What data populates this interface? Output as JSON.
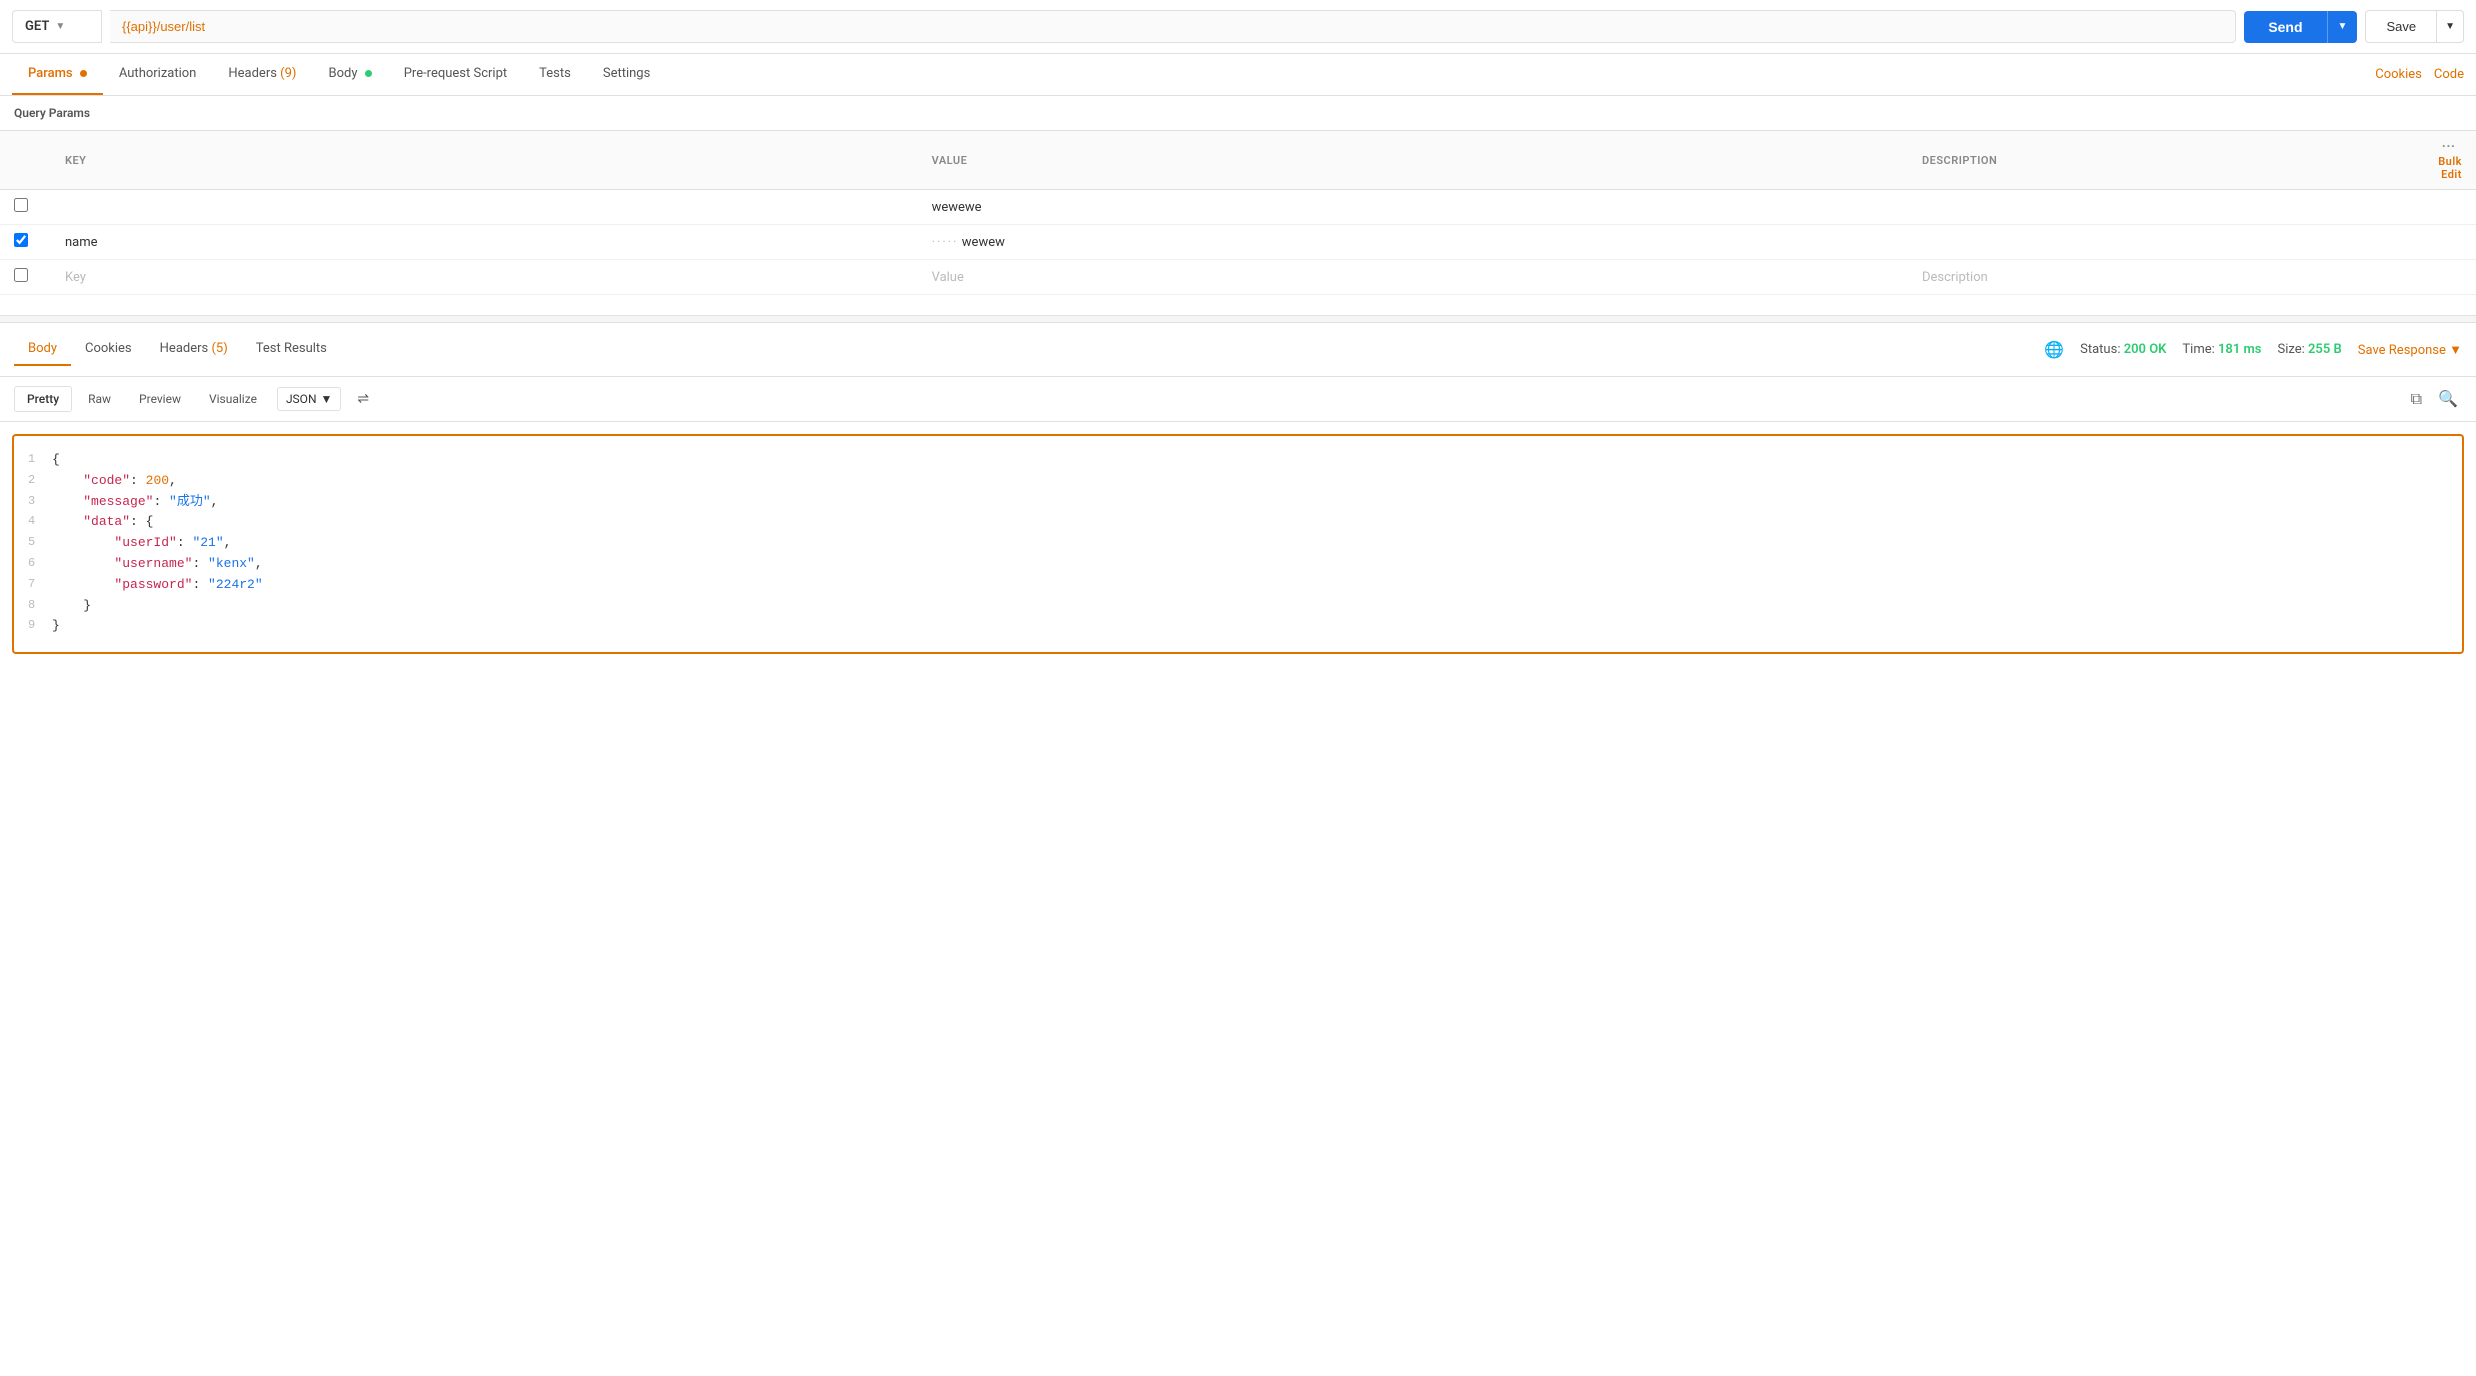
{
  "topbar": {
    "method": "GET",
    "method_chevron": "▼",
    "url": "{{api}}/user/list",
    "send_label": "Send",
    "send_chevron": "▼",
    "save_label": "Save",
    "save_chevron": "▼"
  },
  "tabs": [
    {
      "id": "params",
      "label": "Params",
      "active": true,
      "dot": "orange"
    },
    {
      "id": "authorization",
      "label": "Authorization",
      "active": false
    },
    {
      "id": "headers",
      "label": "Headers",
      "active": false,
      "count": "(9)",
      "count_colored": true
    },
    {
      "id": "body",
      "label": "Body",
      "active": false,
      "dot": "green"
    },
    {
      "id": "pre-request",
      "label": "Pre-request Script",
      "active": false
    },
    {
      "id": "tests",
      "label": "Tests",
      "active": false
    },
    {
      "id": "settings",
      "label": "Settings",
      "active": false
    }
  ],
  "right_links": [
    {
      "id": "cookies",
      "label": "Cookies"
    },
    {
      "id": "code",
      "label": "Code"
    }
  ],
  "query_params": {
    "section_title": "Query Params",
    "columns": {
      "key": "KEY",
      "value": "VALUE",
      "description": "DESCRIPTION"
    },
    "rows": [
      {
        "checked": false,
        "key": "",
        "value": "wewewe",
        "description": "",
        "placeholder_key": "",
        "placeholder_value": "",
        "placeholder_desc": ""
      },
      {
        "checked": true,
        "key": "name",
        "value": "wewew",
        "description": "",
        "value_hidden": true
      },
      {
        "checked": false,
        "key": "Key",
        "value": "Value",
        "description": "Description",
        "is_placeholder": true
      }
    ],
    "three_dots": "···",
    "bulk_edit": "Bulk Edit"
  },
  "response": {
    "tabs": [
      {
        "id": "body",
        "label": "Body",
        "active": true
      },
      {
        "id": "cookies",
        "label": "Cookies",
        "active": false
      },
      {
        "id": "headers",
        "label": "Headers",
        "active": false,
        "count": "(5)"
      },
      {
        "id": "test-results",
        "label": "Test Results",
        "active": false
      }
    ],
    "meta": {
      "status_label": "Status:",
      "status_value": "200 OK",
      "time_label": "Time:",
      "time_value": "181 ms",
      "size_label": "Size:",
      "size_value": "255 B",
      "save_response": "Save Response",
      "save_chevron": "▼"
    },
    "format_tabs": [
      {
        "id": "pretty",
        "label": "Pretty",
        "active": true
      },
      {
        "id": "raw",
        "label": "Raw",
        "active": false
      },
      {
        "id": "preview",
        "label": "Preview",
        "active": false
      },
      {
        "id": "visualize",
        "label": "Visualize",
        "active": false
      }
    ],
    "format_select": "JSON",
    "format_chevron": "▼",
    "wrap_icon": "⇌",
    "code_lines": [
      {
        "num": 1,
        "content": [
          {
            "type": "plain",
            "text": "{"
          }
        ]
      },
      {
        "num": 2,
        "content": [
          {
            "type": "plain",
            "text": "    "
          },
          {
            "type": "key",
            "text": "\"code\""
          },
          {
            "type": "plain",
            "text": ": "
          },
          {
            "type": "num",
            "text": "200"
          },
          {
            "type": "plain",
            "text": ","
          }
        ]
      },
      {
        "num": 3,
        "content": [
          {
            "type": "plain",
            "text": "    "
          },
          {
            "type": "key",
            "text": "\"message\""
          },
          {
            "type": "plain",
            "text": ": "
          },
          {
            "type": "str",
            "text": "\"成功\""
          },
          {
            "type": "plain",
            "text": ","
          }
        ]
      },
      {
        "num": 4,
        "content": [
          {
            "type": "plain",
            "text": "    "
          },
          {
            "type": "key",
            "text": "\"data\""
          },
          {
            "type": "plain",
            "text": ": {"
          }
        ]
      },
      {
        "num": 5,
        "content": [
          {
            "type": "plain",
            "text": "        "
          },
          {
            "type": "key",
            "text": "\"userId\""
          },
          {
            "type": "plain",
            "text": ": "
          },
          {
            "type": "str",
            "text": "\"21\""
          },
          {
            "type": "plain",
            "text": ","
          }
        ]
      },
      {
        "num": 6,
        "content": [
          {
            "type": "plain",
            "text": "        "
          },
          {
            "type": "key",
            "text": "\"username\""
          },
          {
            "type": "plain",
            "text": ": "
          },
          {
            "type": "str",
            "text": "\"kenx\""
          },
          {
            "type": "plain",
            "text": ","
          }
        ]
      },
      {
        "num": 7,
        "content": [
          {
            "type": "plain",
            "text": "        "
          },
          {
            "type": "key",
            "text": "\"password\""
          },
          {
            "type": "plain",
            "text": ": "
          },
          {
            "type": "str",
            "text": "\"224r2\""
          }
        ]
      },
      {
        "num": 8,
        "content": [
          {
            "type": "plain",
            "text": "    }"
          }
        ]
      },
      {
        "num": 9,
        "content": [
          {
            "type": "plain",
            "text": "}"
          }
        ]
      }
    ]
  }
}
